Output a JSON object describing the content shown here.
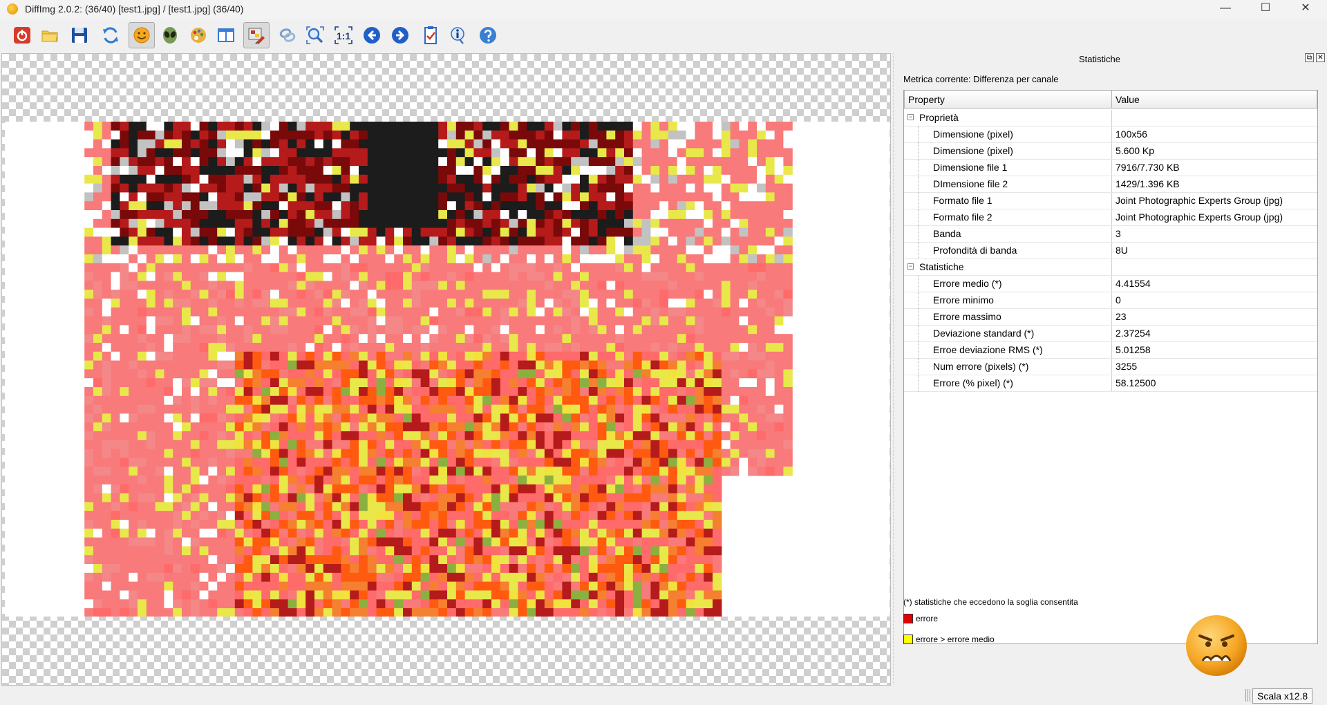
{
  "window": {
    "title": "DiffImg 2.0.2:  (36/40) [test1.jpg] / [test1.jpg] (36/40)",
    "minimize": "—",
    "maximize": "☐",
    "close": "✕"
  },
  "toolbar": {
    "buttons": [
      {
        "name": "exit-icon",
        "color": "#d83b2a"
      },
      {
        "name": "open-folder-icon",
        "color": "#f2c94c"
      },
      {
        "name": "save-icon",
        "color": "#1e4fa3"
      },
      {
        "name": "refresh-icon",
        "color": "#2e7bd6"
      },
      {
        "name": "smiley-icon",
        "color": "#f5a623",
        "active": true
      },
      {
        "name": "alien-icon",
        "color": "#5a7a3a"
      },
      {
        "name": "palette-icon",
        "color": "#e0a030"
      },
      {
        "name": "dual-view-icon",
        "color": "#3a7bd5"
      },
      {
        "name": "diff-mask-icon",
        "color": "#c0392b",
        "active": true
      },
      {
        "name": "link-icon",
        "color": "#7da0c8"
      },
      {
        "name": "zoom-fit-icon",
        "color": "#3a6fc4"
      },
      {
        "name": "zoom-1-1-icon",
        "color": "#1a3c78"
      },
      {
        "name": "arrow-left-icon",
        "color": "#1f5fc8"
      },
      {
        "name": "arrow-right-icon",
        "color": "#1f5fc8"
      },
      {
        "name": "checklist-icon",
        "color": "#2a6ac8"
      },
      {
        "name": "info-icon",
        "color": "#3a6fc4"
      },
      {
        "name": "help-icon",
        "color": "#3a7fd0"
      }
    ]
  },
  "panel": {
    "title": "Statistiche",
    "float_icon": "⧉",
    "close_icon": "✕",
    "metric_label": "Metrica corrente: Differenza per canale",
    "table": {
      "columns": [
        "Property",
        "Value"
      ],
      "groups": [
        {
          "label": "Proprietà",
          "expander": "−",
          "rows": [
            {
              "name": "Dimensione (pixel)",
              "value": "100x56"
            },
            {
              "name": "Dimensione (pixel)",
              "value": "5.600 Kp"
            },
            {
              "name": "Dimensione file 1",
              "value": "7916/7.730 KB"
            },
            {
              "name": "DImensione file 2",
              "value": "1429/1.396 KB"
            },
            {
              "name": "Formato file 1",
              "value": "Joint Photographic Experts Group (jpg)"
            },
            {
              "name": "Formato file 2",
              "value": "Joint Photographic Experts Group (jpg)"
            },
            {
              "name": "Banda",
              "value": "3"
            },
            {
              "name": "Profondità di banda",
              "value": "8U"
            }
          ]
        },
        {
          "label": "Statistiche",
          "expander": "−",
          "rows": [
            {
              "name": "Errore medio (*)",
              "value": "4.41554"
            },
            {
              "name": "Errore minimo",
              "value": "0"
            },
            {
              "name": "Errore massimo",
              "value": "23"
            },
            {
              "name": "Deviazione standard (*)",
              "value": "2.37254"
            },
            {
              "name": "Erroe deviazione RMS (*)",
              "value": "5.01258"
            },
            {
              "name": "Num errore (pixels) (*)",
              "value": "3255"
            },
            {
              "name": "Errore (% pixel) (*)",
              "value": "58.12500"
            }
          ]
        }
      ]
    },
    "footnote": "(*) statistiche che eccedono la soglia consentita",
    "legend": [
      {
        "label": "errore",
        "color": "#e00000"
      },
      {
        "label": "errore > errore medio",
        "color": "#ffff00"
      }
    ],
    "result_face": "sad-face-icon"
  },
  "viewer": {
    "palette": [
      "#ffffff",
      "#f87a7a",
      "#f48787",
      "#ff6a6a",
      "#b51b1b",
      "#7a0a0a",
      "#1c1c1c",
      "#e8e84a",
      "#f2e23e",
      "#ff5a10",
      "#f58030",
      "#8cb040",
      "#c2c2c2"
    ]
  },
  "statusbar": {
    "scale": "Scala x12.8"
  }
}
